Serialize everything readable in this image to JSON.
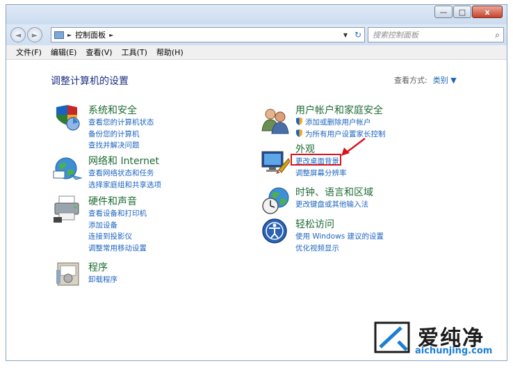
{
  "window": {
    "minimize_glyph": "—",
    "maximize_glyph": "□",
    "close_glyph": "x"
  },
  "nav": {
    "back_glyph": "◄",
    "forward_glyph": "►",
    "breadcrumb": "控制面板",
    "breadcrumb_sep": "►",
    "dropdown_glyph": "▼",
    "refresh_glyph": "↻"
  },
  "search": {
    "placeholder": "搜索控制面板",
    "icon_glyph": "⌕"
  },
  "menu": {
    "file": "文件(F)",
    "edit": "编辑(E)",
    "view": "查看(V)",
    "tools": "工具(T)",
    "help": "帮助(H)"
  },
  "page": {
    "title": "调整计算机的设置",
    "view_by_label": "查看方式:",
    "view_by_value": "类别 ▼"
  },
  "categories": {
    "system": {
      "title": "系统和安全",
      "items": [
        "查看您的计算机状态",
        "备份您的计算机",
        "查找并解决问题"
      ]
    },
    "network": {
      "title": "网络和 Internet",
      "items": [
        "查看网络状态和任务",
        "选择家庭组和共享选项"
      ]
    },
    "hardware": {
      "title": "硬件和声音",
      "items": [
        "查看设备和打印机",
        "添加设备",
        "连接到投影仪",
        "调整常用移动设置"
      ]
    },
    "programs": {
      "title": "程序",
      "items": [
        "卸载程序"
      ]
    },
    "users": {
      "title": "用户帐户和家庭安全",
      "items": [
        "添加或删除用户帐户",
        "为所有用户设置家长控制"
      ]
    },
    "appearance": {
      "title": "外观",
      "items": [
        "更改桌面背景",
        "调整屏幕分辨率"
      ]
    },
    "clock": {
      "title": "时钟、语言和区域",
      "items": [
        "更改键盘或其他输入法"
      ]
    },
    "ease": {
      "title": "轻松访问",
      "items": [
        "使用 Windows 建议的设置",
        "优化视频显示"
      ]
    }
  },
  "watermark": {
    "brand": "爱纯净",
    "url": "aichunjing.com"
  },
  "colors": {
    "category_title": "#1e6b33",
    "link": "#1e65c0",
    "page_title": "#1e3287",
    "highlight": "#d8141d"
  }
}
